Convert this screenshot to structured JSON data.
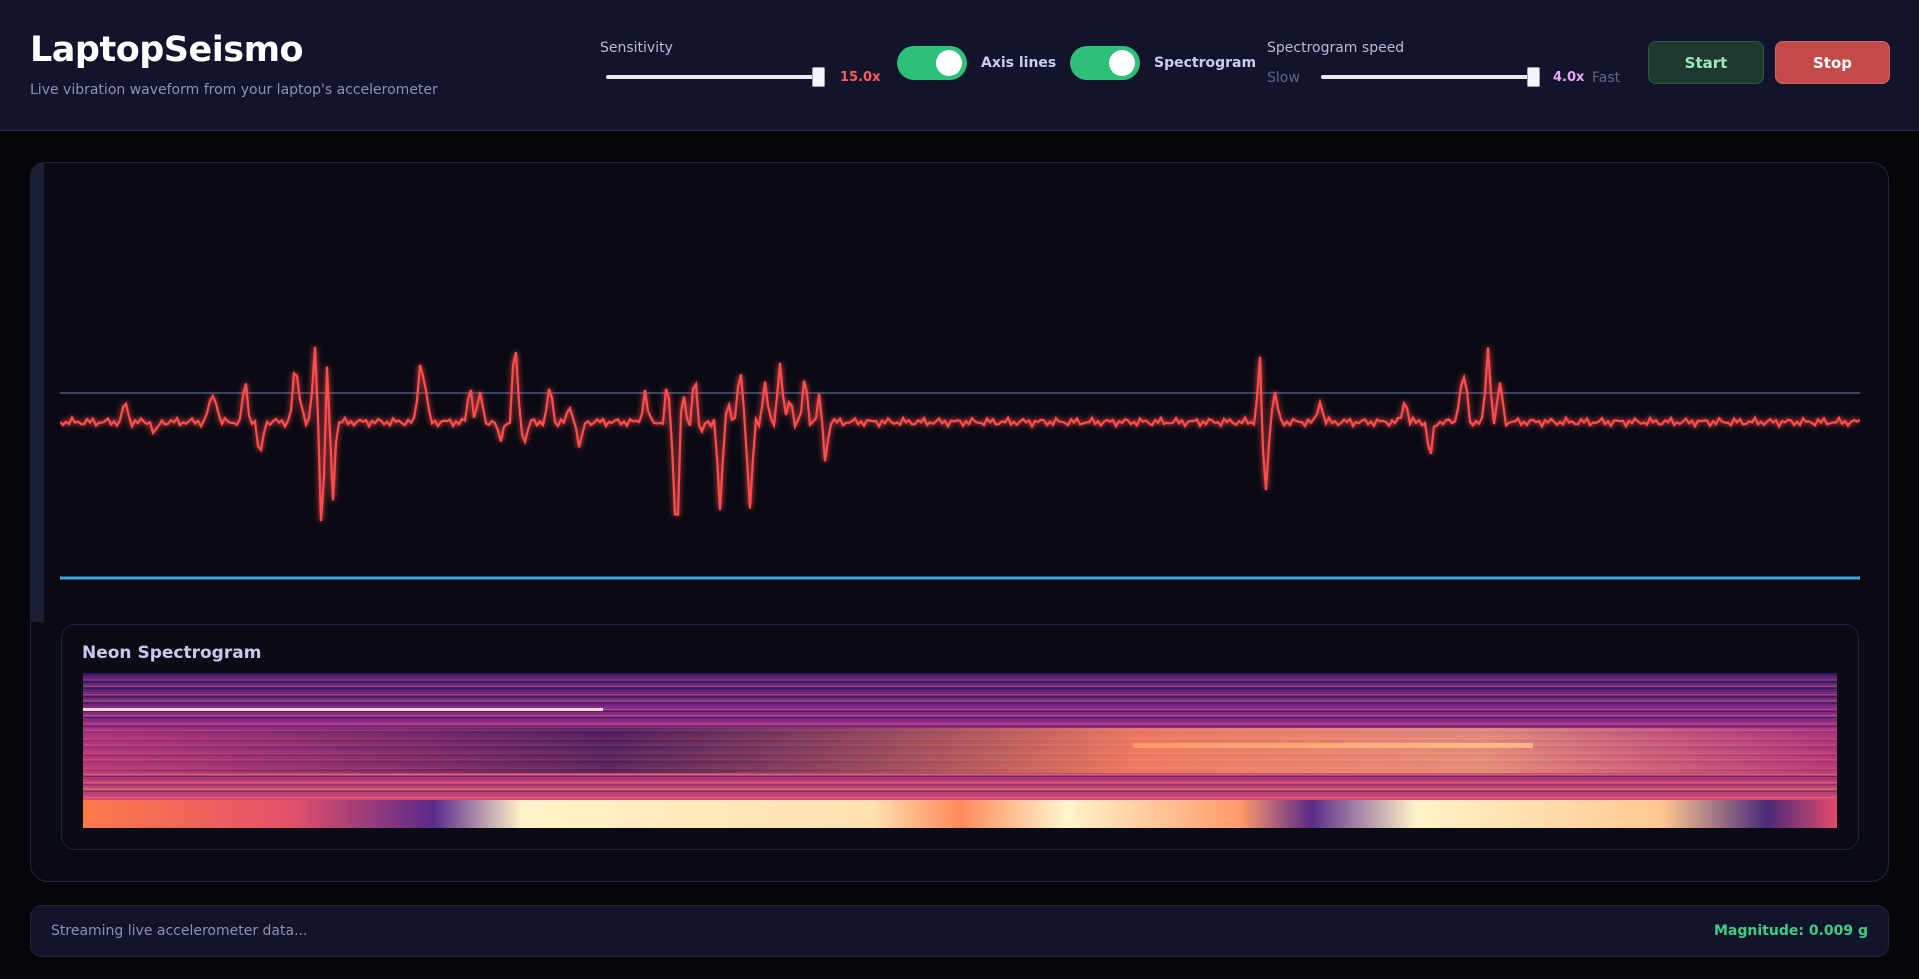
{
  "header": {
    "title": "LaptopSeismo",
    "subtitle": "Live vibration waveform from your laptop's accelerometer"
  },
  "controls": {
    "sensitivity": {
      "label": "Sensitivity",
      "value_text": "15.0x",
      "value_color": "#ff5a5a",
      "level": 1.0
    },
    "axis_lines": {
      "label": "Axis lines",
      "on": true
    },
    "spectrogram": {
      "label": "Spectrogram",
      "on": true
    },
    "speed": {
      "label": "Spectrogram speed",
      "slow_label": "Slow",
      "fast_label": "Fast",
      "value_text": "4.0x",
      "value_color": "#e9a7ff",
      "level": 1.0
    },
    "start_label": "Start",
    "stop_label": "Stop"
  },
  "spectrogram_panel": {
    "title": "Neon Spectrogram"
  },
  "status": {
    "message": "Streaming live accelerometer data...",
    "magnitude": "Magnitude: 0.009 g"
  },
  "colors": {
    "accent_green": "#2cc078",
    "waveform": "#ff4d4d",
    "axis_line": "#3aa6d8",
    "stop": "#c44a4a"
  }
}
